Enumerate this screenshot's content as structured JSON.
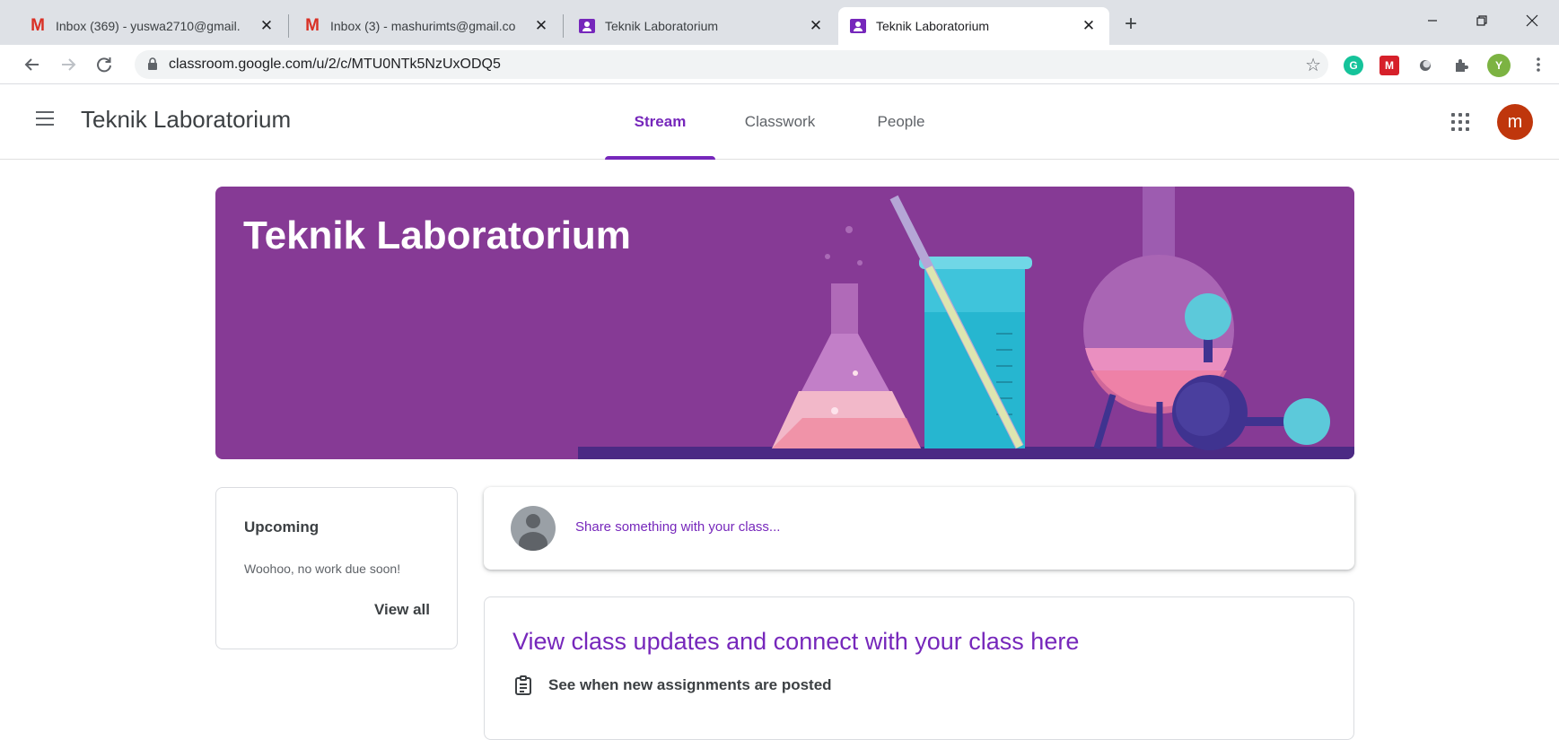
{
  "browser": {
    "tabs": [
      {
        "title": "Inbox (369) - yuswa2710@gmail.",
        "favicon": "gmail-icon",
        "active": false
      },
      {
        "title": "Inbox (3) - mashurimts@gmail.co",
        "favicon": "gmail-icon",
        "active": false
      },
      {
        "title": "Teknik Laboratorium",
        "favicon": "classroom-icon",
        "active": false
      },
      {
        "title": "Teknik Laboratorium",
        "favicon": "classroom-icon",
        "active": true
      }
    ],
    "new_tab_label": "+",
    "address": "classroom.google.com/u/2/c/MTU0NTk5NzUxODQ5",
    "profile_initial": "Y",
    "extensions": [
      "grammarly-icon",
      "mendeley-icon",
      "circle-extension-icon",
      "puzzle-icon"
    ]
  },
  "app": {
    "class_name": "Teknik Laboratorium",
    "tabs": [
      {
        "label": "Stream",
        "active": true
      },
      {
        "label": "Classwork",
        "active": false
      },
      {
        "label": "People",
        "active": false
      }
    ],
    "account_initial": "m"
  },
  "banner": {
    "title": "Teknik Laboratorium",
    "theme": "science-lab",
    "color": "#863a95"
  },
  "upcoming": {
    "title": "Upcoming",
    "empty_text": "Woohoo, no work due soon!",
    "view_all": "View all"
  },
  "share": {
    "placeholder": "Share something with your class..."
  },
  "updates": {
    "heading": "View class updates and connect with your class here",
    "items": [
      {
        "icon": "assignment-icon",
        "text": "See when new assignments are posted"
      }
    ]
  },
  "colors": {
    "accent": "#7627bb",
    "banner": "#863a95",
    "avatar": "#bf360c"
  }
}
